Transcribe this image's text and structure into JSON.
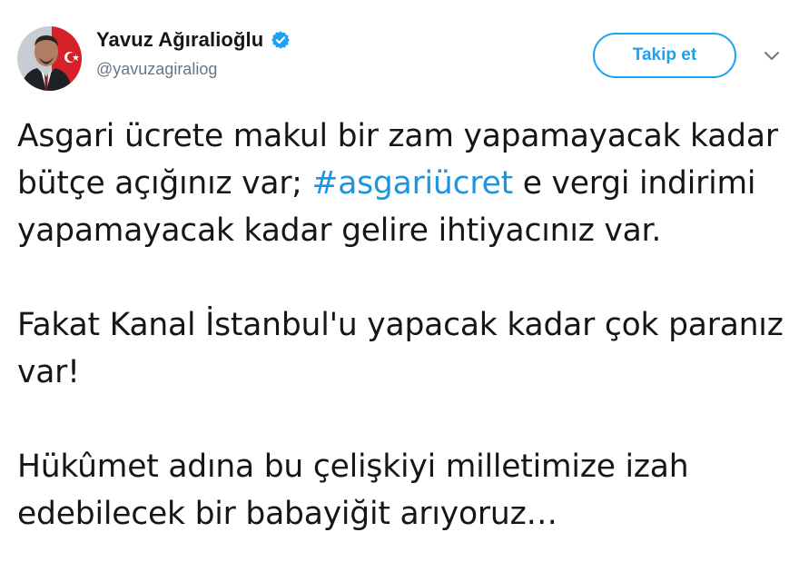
{
  "author": {
    "display_name": "Yavuz Ağıralioğlu",
    "handle": "@yavuzagiraliog",
    "verified": true,
    "avatar_icon": "profile-photo-with-turkish-flag"
  },
  "actions": {
    "follow_label": "Takip et",
    "menu_icon": "chevron-down-icon"
  },
  "tweet": {
    "line1": "Asgari ücrete makul bir zam yapamayacak kadar bütçe açığınız var; ",
    "hashtag": "#asgariücret",
    "line1_after": " e vergi indirimi yapamayacak kadar gelire ihtiyacınız var.",
    "paragraph2": "Fakat Kanal İstanbul'u yapacak kadar çok paranız var!",
    "paragraph3": "Hükûmet adına bu çelişkiyi milletimize izah edebilecek bir babayiğit arıyoruz…"
  },
  "colors": {
    "accent": "#1da1f2",
    "hashtag": "#1b95e0",
    "text": "#14171a",
    "secondary": "#657786"
  }
}
